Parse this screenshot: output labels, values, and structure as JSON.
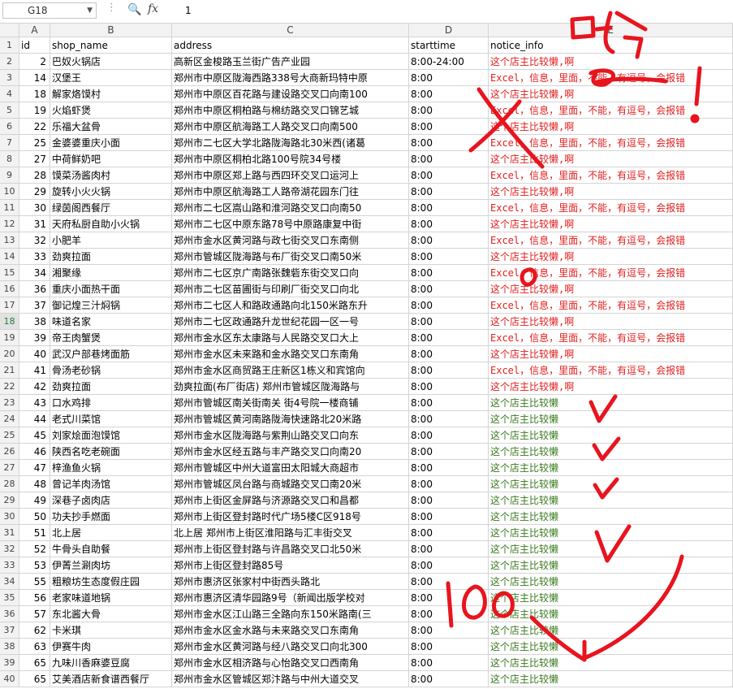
{
  "formula_bar": {
    "cell_ref": "G18",
    "dropdown_icon": "chevron-down-icon",
    "search_icon": "zoom-icon",
    "fx_label": "fx",
    "value": "1"
  },
  "columns": [
    "A",
    "B",
    "C",
    "D",
    "E"
  ],
  "selected_row": 18,
  "rows": [
    {
      "n": "1",
      "id": "id",
      "shop": "shop_name",
      "addr": "address",
      "start": "starttime",
      "notice": "notice_info",
      "style": "header"
    },
    {
      "n": "2",
      "id": "2",
      "shop": "巴奴火锅店",
      "addr": "高新区金梭路玉兰街广告产业园",
      "start": "8:00-24:00",
      "notice": "这个店主比较懒,啊",
      "style": "red"
    },
    {
      "n": "3",
      "id": "14",
      "shop": "汉堡王",
      "addr": " 郑州市中原区陇海西路338号大商新玛特中原",
      "start": "8:00",
      "notice": "Excel，信息，里面，不能，有逗号，会报错",
      "style": "red"
    },
    {
      "n": "4",
      "id": "18",
      "shop": "解家烙馍村",
      "addr": "郑州市中原区百花路与建设路交叉口向南100",
      "start": "8:00",
      "notice": "这个店主比较懒,啊",
      "style": "red"
    },
    {
      "n": "5",
      "id": "19",
      "shop": "火焰虾煲",
      "addr": "郑州市中原区桐柏路与棉纺路交叉口锦艺城",
      "start": "8:00",
      "notice": "Excel，信息，里面，不能，有逗号，会报错",
      "style": "red"
    },
    {
      "n": "6",
      "id": "22",
      "shop": "乐福大盆骨",
      "addr": "郑州市中原区航海路工人路交叉口向南500",
      "start": "8:00",
      "notice": "这个店主比较懒,啊",
      "style": "red"
    },
    {
      "n": "7",
      "id": "25",
      "shop": "金婆婆重庆小面",
      "addr": "郑州市二七区大学北路陇海路北30米西(诸葛",
      "start": "8:00",
      "notice": "Excel，信息，里面，不能，有逗号，会报错",
      "style": "red"
    },
    {
      "n": "8",
      "id": "27",
      "shop": "中荷鲜奶吧",
      "addr": "郑州市中原区桐柏北路100号院34号楼",
      "start": "8:00",
      "notice": "这个店主比较懒,啊",
      "style": "red"
    },
    {
      "n": "9",
      "id": "28",
      "shop": "馍菜汤酱肉村",
      "addr": "郑州市中原区郑上路与西四环交叉口运河上",
      "start": "8:00",
      "notice": "Excel，信息，里面，不能，有逗号，会报错",
      "style": "red"
    },
    {
      "n": "10",
      "id": "29",
      "shop": "旋转小火火锅",
      "addr": "郑州市中原区航海路工人路帝湖花园东门往",
      "start": "8:00",
      "notice": "这个店主比较懒,啊",
      "style": "red"
    },
    {
      "n": "11",
      "id": "30",
      "shop": "绿茵阁西餐厅",
      "addr": "郑州市二七区嵩山路和淮河路交叉口向南50",
      "start": "8:00",
      "notice": "Excel，信息，里面，不能，有逗号，会报错",
      "style": "red"
    },
    {
      "n": "12",
      "id": "31",
      "shop": "天府私厨自助小火锅",
      "addr": "郑州市二七区中原东路78号中原路康复中街",
      "start": "8:00",
      "notice": "这个店主比较懒,啊",
      "style": "red"
    },
    {
      "n": "13",
      "id": "32",
      "shop": "小肥羊",
      "addr": "郑州市金水区黄河路与政七街交叉口东南侧",
      "start": "8:00",
      "notice": "Excel，信息，里面，不能，有逗号，会报错",
      "style": "red"
    },
    {
      "n": "14",
      "id": "33",
      "shop": "劲爽拉面",
      "addr": "郑州市管城区陇海路与布厂街交叉口南50米",
      "start": "8:00",
      "notice": "这个店主比较懒,啊",
      "style": "red"
    },
    {
      "n": "15",
      "id": "34",
      "shop": "湘聚缘",
      "addr": "郑州市二七区京广南路张魏砦东街交叉口向",
      "start": "8:00",
      "notice": "Excel，信息，里面，不能，有逗号，会报错",
      "style": "red"
    },
    {
      "n": "16",
      "id": "36",
      "shop": "重庆小面热干面",
      "addr": "郑州市二七区苗圃街与印刷厂街交叉口向北",
      "start": "8:00",
      "notice": "这个店主比较懒,啊",
      "style": "red"
    },
    {
      "n": "17",
      "id": "37",
      "shop": "御记煌三汁焖锅",
      "addr": "郑州市二七区人和路政通路向北150米路东升",
      "start": "8:00",
      "notice": "Excel，信息，里面，不能，有逗号，会报错",
      "style": "red"
    },
    {
      "n": "18",
      "id": "38",
      "shop": "味道名家",
      "addr": "郑州市二七区政通路升龙世纪花园一区一号",
      "start": "8:00",
      "notice": "这个店主比较懒,啊",
      "style": "red"
    },
    {
      "n": "19",
      "id": "39",
      "shop": "帝王肉蟹煲",
      "addr": "郑州市金水区东太康路与人民路交叉口大上",
      "start": "8:00",
      "notice": "Excel，信息，里面，不能，有逗号，会报错",
      "style": "red"
    },
    {
      "n": "20",
      "id": "40",
      "shop": "武汉户部巷烤面筋",
      "addr": "郑州市金水区未来路和金水路交叉口东南角",
      "start": "8:00",
      "notice": "这个店主比较懒,啊",
      "style": "red"
    },
    {
      "n": "21",
      "id": "41",
      "shop": "骨汤老砂锅",
      "addr": "郑州市金水区商贸路王庄新区1栋义和宾馆向",
      "start": "8:00",
      "notice": "Excel，信息，里面，不能，有逗号，会报错",
      "style": "red"
    },
    {
      "n": "22",
      "id": "42",
      "shop": "劲爽拉面",
      "addr": "劲爽拉面(布厂街店)    郑州市管城区陇海路与",
      "start": "8:00",
      "notice": "这个店主比较懒,啊",
      "style": "red"
    },
    {
      "n": "23",
      "id": "43",
      "shop": "口水鸡排",
      "addr": "郑州市管城区南关街南关 街4号院一楼商铺",
      "start": "8:00",
      "notice": "这个店主比较懒",
      "style": "green"
    },
    {
      "n": "24",
      "id": "44",
      "shop": "老式川菜馆",
      "addr": "郑州市管城区黄河南路陇海快速路北20米路",
      "start": "8:00",
      "notice": "这个店主比较懒",
      "style": "green"
    },
    {
      "n": "25",
      "id": "45",
      "shop": "刘家烩面泡馍馆",
      "addr": "郑州市金水区陇海路与紫荆山路交叉口向东",
      "start": "8:00",
      "notice": "这个店主比较懒",
      "style": "green"
    },
    {
      "n": "26",
      "id": "46",
      "shop": "陕西名吃老碗面",
      "addr": "郑州市金水区经五路与丰产路交叉口向南20",
      "start": "8:00",
      "notice": "这个店主比较懒",
      "style": "green"
    },
    {
      "n": "27",
      "id": "47",
      "shop": "梓渔鱼火锅",
      "addr": "郑州市管城区中州大道富田太阳城大商超市",
      "start": "8:00",
      "notice": "这个店主比较懒",
      "style": "green"
    },
    {
      "n": "28",
      "id": "48",
      "shop": "曾记羊肉汤馆",
      "addr": "郑州市管城区凤台路与商城路交叉口南20米",
      "start": "8:00",
      "notice": "这个店主比较懒",
      "style": "green"
    },
    {
      "n": "29",
      "id": "49",
      "shop": "深巷子卤肉店",
      "addr": "郑州市上街区金屏路与济源路交叉口和昌都",
      "start": "8:00",
      "notice": "这个店主比较懒",
      "style": "green"
    },
    {
      "n": "30",
      "id": "50",
      "shop": "功夫抄手燃面",
      "addr": "郑州市上街区登封路时代广场5楼C区918号",
      "start": "8:00",
      "notice": "这个店主比较懒",
      "style": "green"
    },
    {
      "n": "31",
      "id": "51",
      "shop": "北上居",
      "addr": "北上居    郑州市上街区淮阳路与汇丰街交叉",
      "start": "8:00",
      "notice": "这个店主比较懒",
      "style": "green"
    },
    {
      "n": "32",
      "id": "52",
      "shop": "牛骨头自助餐",
      "addr": "郑州市上街区登封路与许昌路交叉口北50米",
      "start": "8:00",
      "notice": "这个店主比较懒",
      "style": "green"
    },
    {
      "n": "33",
      "id": "53",
      "shop": "伊菁兰涮肉坊",
      "addr": "郑州市上街区登封路85号",
      "start": "8:00",
      "notice": "这个店主比较懒",
      "style": "green"
    },
    {
      "n": "34",
      "id": "55",
      "shop": "粗粮坊生态度假庄园",
      "addr": "郑州市惠济区张家村中街西头路北",
      "start": "8:00",
      "notice": "这个店主比较懒",
      "style": "green"
    },
    {
      "n": "35",
      "id": "56",
      "shop": "老家味道地锅",
      "addr": "郑州市惠济区清华园路9号（新闻出版学校对",
      "start": "8:00",
      "notice": "这个店主比较懒",
      "style": "green"
    },
    {
      "n": "36",
      "id": "57",
      "shop": "东北酱大骨",
      "addr": "郑州市金水区江山路三全路向东150米路南(三",
      "start": "8:00",
      "notice": "这个店主比较懒",
      "style": "green"
    },
    {
      "n": "37",
      "id": "62",
      "shop": "卡米琪",
      "addr": "郑州市金水区金水路与未来路交叉口东南角",
      "start": "8:00",
      "notice": "这个店主比较懒",
      "style": "green"
    },
    {
      "n": "38",
      "id": "63",
      "shop": "伊赛牛肉",
      "addr": "郑州市金水区黄河路与经八路交叉口向北300",
      "start": "8:00",
      "notice": "这个店主比较懒",
      "style": "green"
    },
    {
      "n": "39",
      "id": "65",
      "shop": "九味川香麻婆豆腐",
      "addr": "郑州市金水区相济路与心怡路交叉口西南角",
      "start": "8:00",
      "notice": "这个店主比较懒",
      "style": "green"
    },
    {
      "n": "40",
      "id": "65",
      "shop": "艾美酒店新食谱西餐厅",
      "addr": "郑州市金水区管城区郑汴路与中州大道交叉",
      "start": "8:00",
      "notice": "这个店主比较懒",
      "style": "green"
    }
  ],
  "annotations": {
    "scrawl_top": "哈分",
    "scrawl_bottom": "100",
    "ink_color": "#e8141e"
  }
}
